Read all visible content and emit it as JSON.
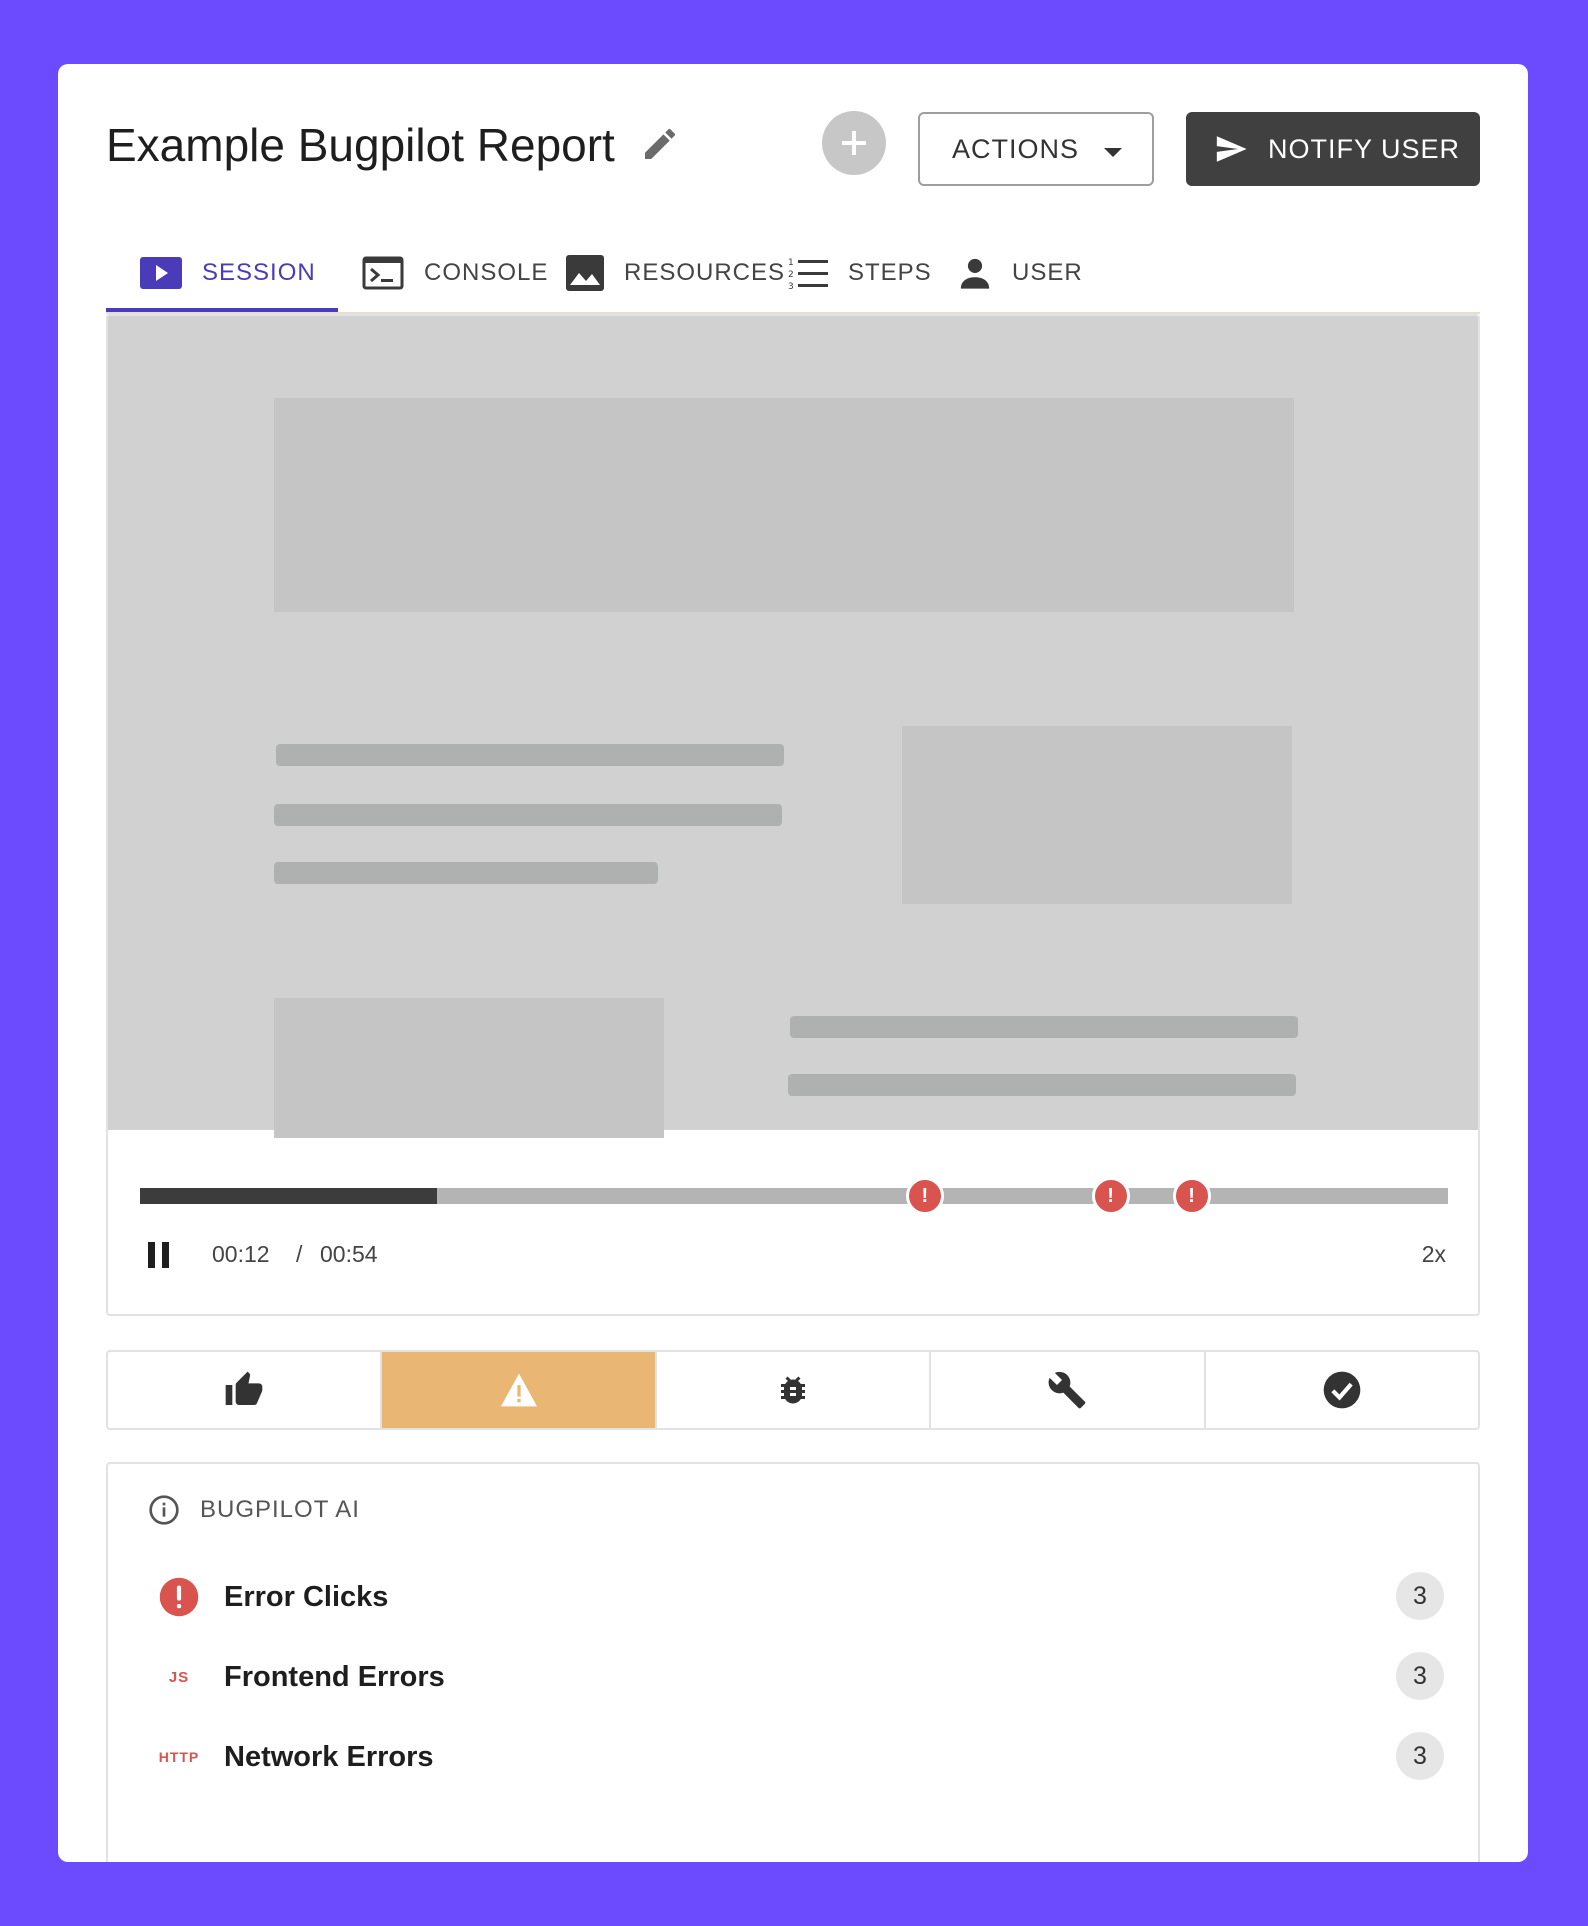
{
  "header": {
    "title": "Example Bugpilot Report",
    "actions_label": "ACTIONS",
    "notify_label": "NOTIFY USER"
  },
  "tabs": [
    {
      "label": "SESSION",
      "icon": "play-icon",
      "active": true
    },
    {
      "label": "CONSOLE",
      "icon": "terminal-icon",
      "active": false
    },
    {
      "label": "RESOURCES",
      "icon": "image-icon",
      "active": false
    },
    {
      "label": "STEPS",
      "icon": "numbered-list-icon",
      "active": false
    },
    {
      "label": "USER",
      "icon": "person-icon",
      "active": false
    }
  ],
  "player": {
    "current_time": "00:12",
    "separator": "/",
    "total_time": "00:54",
    "speed": "2x",
    "progress_fraction": 0.227,
    "error_marker_times": [
      0.6,
      0.742,
      0.804
    ],
    "error_marker_glyph": "!"
  },
  "feedback": [
    {
      "icon": "thumbs-up-icon",
      "active": false
    },
    {
      "icon": "warning-icon",
      "active": true
    },
    {
      "icon": "bug-icon",
      "active": false
    },
    {
      "icon": "wrench-icon",
      "active": false
    },
    {
      "icon": "check-circle-icon",
      "active": false
    }
  ],
  "ai": {
    "title": "BUGPILOT AI",
    "issues": [
      {
        "label": "Error Clicks",
        "count": "3",
        "icon": "error-circle-icon"
      },
      {
        "label": "Frontend Errors",
        "count": "3",
        "icon": "js-icon",
        "tag": "JS"
      },
      {
        "label": "Network Errors",
        "count": "3",
        "icon": "http-icon",
        "tag": "HTTP"
      }
    ]
  },
  "colors": {
    "background": "#6c4afd",
    "accent": "#4a3bb8",
    "error": "#d9534f",
    "warning_active": "#e9b674",
    "dark_button": "#404040"
  }
}
